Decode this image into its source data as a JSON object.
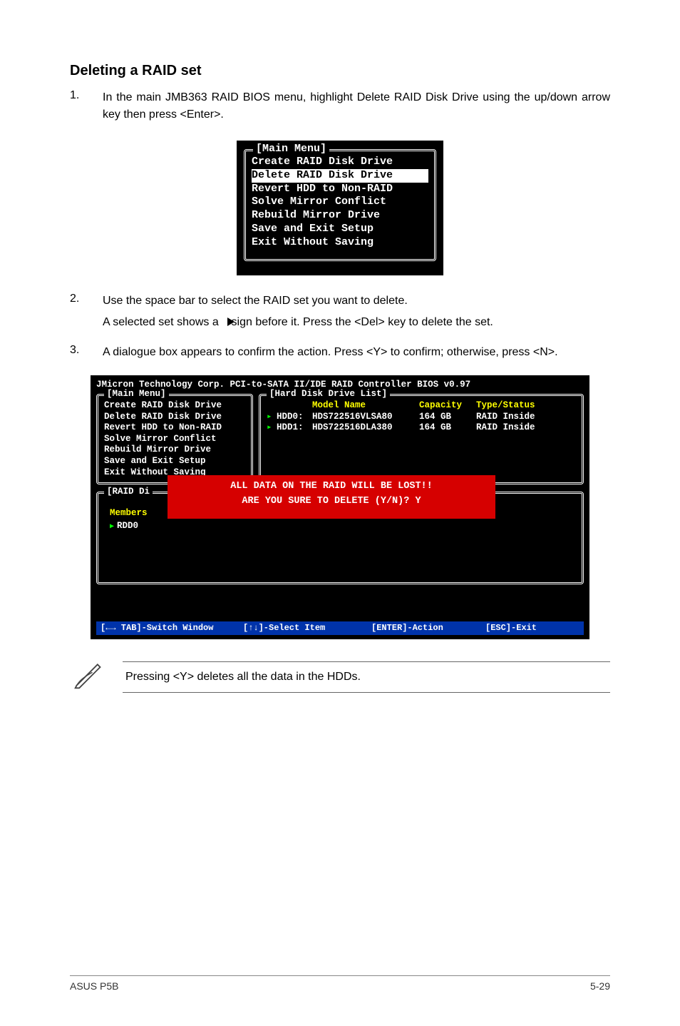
{
  "heading": "Deleting a RAID set",
  "steps": [
    {
      "num": "1.",
      "paras": [
        "In the main JMB363 RAID BIOS menu, highlight Delete RAID Disk Drive using the up/down arrow key then press <Enter>."
      ]
    },
    {
      "num": "2.",
      "paras": [
        "Use the space bar to select the RAID set you want to delete.",
        "A selected set shows a    sign before it. Press the <Del> key to delete the set."
      ]
    },
    {
      "num": "3.",
      "paras": [
        "A dialogue box appears to confirm the action. Press <Y> to confirm; otherwise, press <N>."
      ]
    }
  ],
  "biosSmall": {
    "title": "[Main Menu]",
    "lines": [
      {
        "text": "Create RAID Disk Drive",
        "sel": false
      },
      {
        "text": "Delete RAID Disk Drive",
        "sel": true
      },
      {
        "text": "Revert HDD to Non-RAID",
        "sel": false
      },
      {
        "text": "Solve Mirror Conflict",
        "sel": false
      },
      {
        "text": "Rebuild Mirror Drive",
        "sel": false
      },
      {
        "text": "Save and Exit Setup",
        "sel": false
      },
      {
        "text": "Exit Without Saving",
        "sel": false
      }
    ]
  },
  "biosLarge": {
    "topLine": "JMicron Technology Corp. PCI-to-SATA II/IDE RAID Controller BIOS v0.97",
    "leftTitle": "[Main Menu]",
    "leftLines": [
      "Create RAID Disk Drive",
      "Delete RAID Disk Drive",
      "Revert HDD to Non-RAID",
      "Solve Mirror Conflict",
      "Rebuild Mirror Drive",
      "Save and Exit Setup",
      "Exit Without Saving"
    ],
    "rightTitle": "[Hard Disk Drive List]",
    "hddHead": {
      "c2": "Model Name",
      "c3": "Capacity",
      "c4": "Type/Status"
    },
    "hddRows": [
      {
        "c1": "HDD0:",
        "c2": "HDS722516VLSA80",
        "c3": "164 GB",
        "c4": "RAID Inside"
      },
      {
        "c1": "HDD1:",
        "c2": "HDS722516DLA380",
        "c3": "164 GB",
        "c4": "RAID Inside"
      }
    ],
    "raidTitle": "[RAID Di",
    "raidMembers": "Members",
    "raidRdd": "RDD0",
    "redDialog": {
      "l1": "ALL DATA ON THE RAID WILL BE LOST!!",
      "l2": "ARE YOU SURE TO DELETE (Y/N)? Y"
    },
    "footer": {
      "f1": "[←→ TAB]-Switch Window",
      "f2": "[↑↓]-Select Item",
      "f3": "[ENTER]-Action",
      "f4": "[ESC]-Exit"
    }
  },
  "noteText": "Pressing <Y> deletes all the data in the HDDs.",
  "footerLeft": "ASUS P5B",
  "footerRight": "5-29"
}
